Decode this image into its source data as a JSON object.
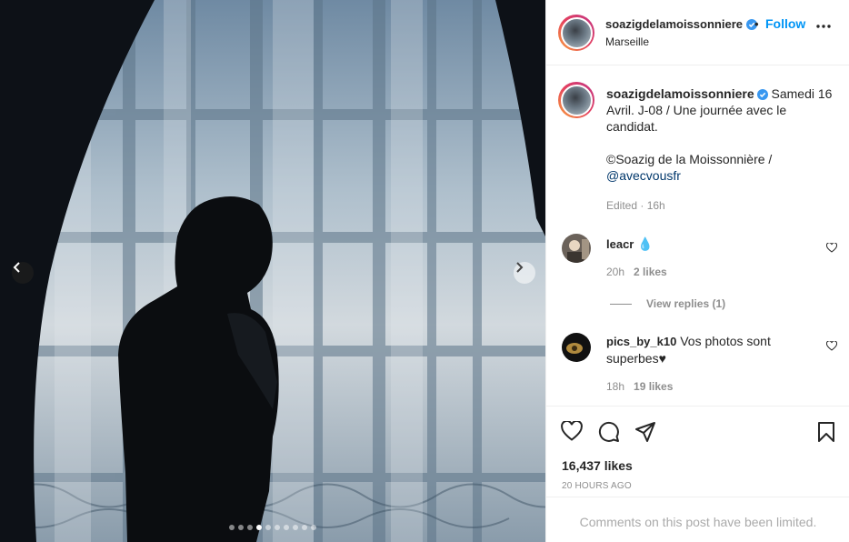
{
  "post": {
    "username": "soazigdelamoissonniere",
    "location": "Marseille",
    "follow_label": "Follow",
    "separator": "•",
    "image_alt": "Silhouette of a man adjusting his collar in front of a bright curtained window",
    "carousel": {
      "count": 10,
      "active_index": 3
    }
  },
  "caption": {
    "username": "soazigdelamoissonniere",
    "text": "Samedi 16 Avril. J-08 / Une journée avec le candidat.",
    "credit": "©Soazig de la Moissonnière / ",
    "mention": "@avecvousfr",
    "meta": "Edited · 16h"
  },
  "comments": [
    {
      "username": "leacr",
      "text": "",
      "emoji": "💧",
      "time": "20h",
      "likes": "2 likes",
      "view_replies": "View replies (1)"
    },
    {
      "username": "pics_by_k10",
      "text": "Vos photos sont superbes♥",
      "time": "18h",
      "likes": "19 likes"
    }
  ],
  "stats": {
    "likes": "16,437 likes",
    "time_ago": "20 HOURS AGO"
  },
  "footer": {
    "limited": "Comments on this post have been limited."
  },
  "icons": {
    "verified": "verified-badge-icon",
    "more": "more-options-icon",
    "like": "heart-icon",
    "comment": "comment-icon",
    "share": "share-icon",
    "save": "bookmark-icon",
    "prev": "chevron-left-icon",
    "next": "chevron-right-icon"
  },
  "colors": {
    "link": "#0095f6",
    "mention": "#00376b",
    "meta": "#8e8e8e",
    "text": "#262626"
  }
}
